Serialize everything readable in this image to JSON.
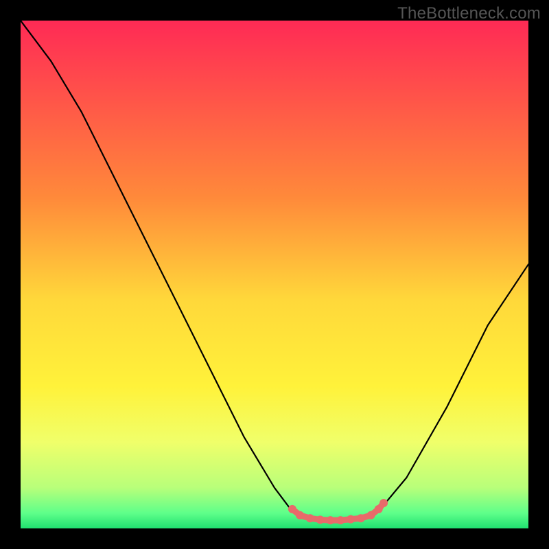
{
  "watermark": "TheBottleneck.com",
  "chart_data": {
    "type": "line",
    "title": "",
    "xlabel": "",
    "ylabel": "",
    "xlim": [
      0,
      100
    ],
    "ylim": [
      0,
      100
    ],
    "gradient_stops": [
      {
        "offset": 0,
        "color": "#ff2a55"
      },
      {
        "offset": 35,
        "color": "#ff8a3a"
      },
      {
        "offset": 55,
        "color": "#ffd83a"
      },
      {
        "offset": 72,
        "color": "#fff23a"
      },
      {
        "offset": 83,
        "color": "#f0ff6a"
      },
      {
        "offset": 92,
        "color": "#b8ff7a"
      },
      {
        "offset": 97,
        "color": "#5eff8a"
      },
      {
        "offset": 100,
        "color": "#20e070"
      }
    ],
    "series": [
      {
        "name": "bottleneck-curve",
        "color": "#000000",
        "stroke_width": 2,
        "points": [
          {
            "x": 0,
            "y": 100
          },
          {
            "x": 6,
            "y": 92
          },
          {
            "x": 12,
            "y": 82
          },
          {
            "x": 22,
            "y": 62
          },
          {
            "x": 34,
            "y": 38
          },
          {
            "x": 44,
            "y": 18
          },
          {
            "x": 50,
            "y": 8
          },
          {
            "x": 53,
            "y": 4
          },
          {
            "x": 56,
            "y": 2.2
          },
          {
            "x": 60,
            "y": 1.6
          },
          {
            "x": 64,
            "y": 1.6
          },
          {
            "x": 68,
            "y": 2.2
          },
          {
            "x": 71,
            "y": 4
          },
          {
            "x": 76,
            "y": 10
          },
          {
            "x": 84,
            "y": 24
          },
          {
            "x": 92,
            "y": 40
          },
          {
            "x": 100,
            "y": 52
          }
        ]
      },
      {
        "name": "highlight-band",
        "color": "#e86a6a",
        "marker_radius": 1.2,
        "stroke_width": 1.2,
        "points": [
          {
            "x": 53.5,
            "y": 3.8
          },
          {
            "x": 55,
            "y": 2.6
          },
          {
            "x": 57,
            "y": 2.0
          },
          {
            "x": 59,
            "y": 1.7
          },
          {
            "x": 61,
            "y": 1.6
          },
          {
            "x": 63,
            "y": 1.6
          },
          {
            "x": 65,
            "y": 1.8
          },
          {
            "x": 67,
            "y": 2.0
          },
          {
            "x": 69,
            "y": 2.6
          },
          {
            "x": 70.5,
            "y": 3.8
          },
          {
            "x": 71.5,
            "y": 5.0
          }
        ]
      }
    ]
  }
}
